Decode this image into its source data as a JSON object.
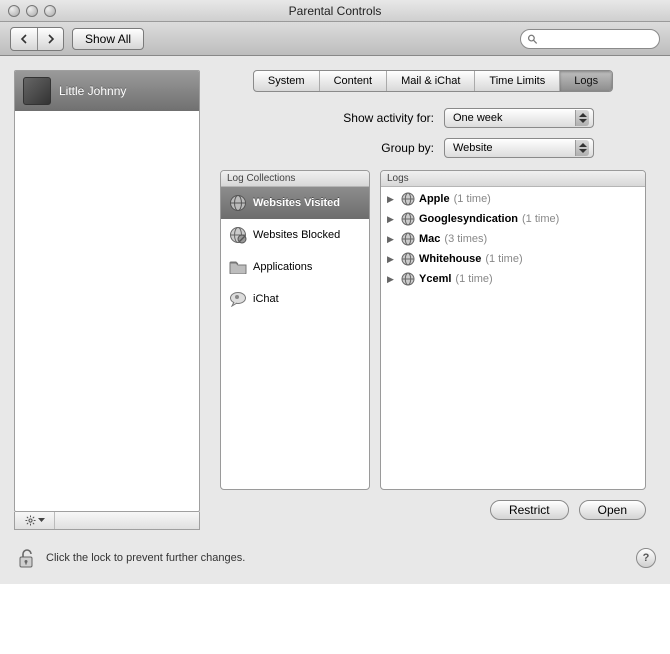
{
  "window": {
    "title": "Parental Controls"
  },
  "toolbar": {
    "show_all_label": "Show All",
    "search_placeholder": ""
  },
  "sidebar": {
    "users": [
      {
        "name": "Little Johnny"
      }
    ]
  },
  "tabs": {
    "items": [
      {
        "label": "System"
      },
      {
        "label": "Content"
      },
      {
        "label": "Mail & iChat"
      },
      {
        "label": "Time Limits"
      },
      {
        "label": "Logs"
      }
    ],
    "selected": "Logs"
  },
  "filters": {
    "activity_label": "Show activity for:",
    "activity_value": "One week",
    "groupby_label": "Group by:",
    "groupby_value": "Website"
  },
  "collections": {
    "header": "Log Collections",
    "items": [
      {
        "label": "Websites Visited",
        "icon": "globe",
        "selected": true
      },
      {
        "label": "Websites Blocked",
        "icon": "globe-blocked",
        "selected": false
      },
      {
        "label": "Applications",
        "icon": "folder",
        "selected": false
      },
      {
        "label": "iChat",
        "icon": "chat",
        "selected": false
      }
    ]
  },
  "logs": {
    "header": "Logs",
    "items": [
      {
        "name": "Apple",
        "count_text": "(1 time)"
      },
      {
        "name": "Googlesyndication",
        "count_text": "(1 time)"
      },
      {
        "name": "Mac",
        "count_text": "(3 times)"
      },
      {
        "name": "Whitehouse",
        "count_text": "(1 time)"
      },
      {
        "name": "Yceml",
        "count_text": "(1 time)"
      }
    ]
  },
  "buttons": {
    "restrict": "Restrict",
    "open": "Open"
  },
  "footer": {
    "lock_text": "Click the lock to prevent further changes."
  }
}
